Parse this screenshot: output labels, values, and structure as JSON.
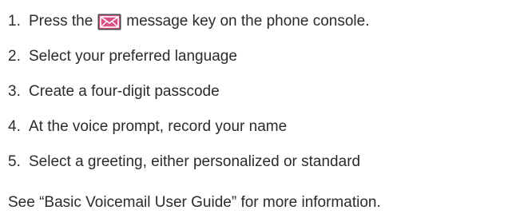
{
  "steps": [
    {
      "number": "1.",
      "before_icon": "Press the",
      "icon": "envelope-icon",
      "after_icon": "message key on the phone console."
    },
    {
      "number": "2.",
      "text": "Select your preferred language"
    },
    {
      "number": "3.",
      "text": "Create a four-digit passcode"
    },
    {
      "number": "4.",
      "text": "At the voice prompt, record your name"
    },
    {
      "number": "5.",
      "text": "Select a greeting, either personalized or standard"
    }
  ],
  "footer": {
    "text": "See “Basic Voicemail User Guide” for more information."
  },
  "colors": {
    "text": "#2b2b2b",
    "icon_frame": "#4a4a4a",
    "icon_fill": "#d94f86",
    "icon_envelope": "#ffffff"
  }
}
